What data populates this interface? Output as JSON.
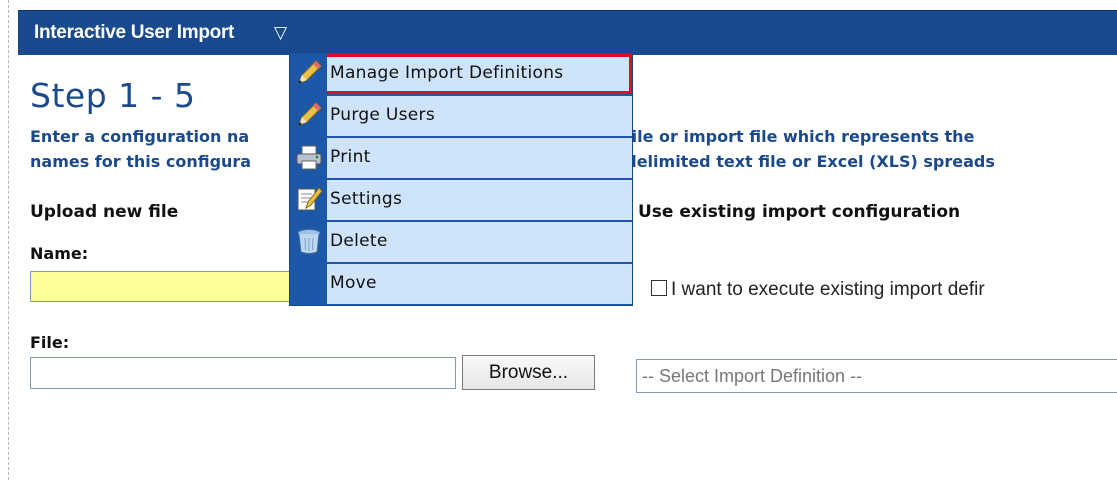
{
  "header": {
    "title": "Interactive User Import",
    "caret": "▽"
  },
  "step": {
    "title": "Step 1 - 5"
  },
  "description": {
    "line1_left": "Enter a configuration na",
    "line1_right": "ort file or import file which represents the",
    "line2_left": "names for this configura",
    "line2_right": "AB delimited text file or Excel (XLS) spreads"
  },
  "upload_section": {
    "title": "Upload new file",
    "name_label": "Name:",
    "name_value": "",
    "file_label": "File:",
    "file_value": "",
    "browse_label": "Browse..."
  },
  "existing_section": {
    "title": "Use existing import configuration",
    "checkbox_label": "I want to execute existing import defir",
    "checkbox_checked": false,
    "select_value": "-- Select Import Definition --"
  },
  "menu": {
    "items": [
      {
        "label": "Manage Import Definitions",
        "icon": "pencil-icon",
        "highlighted": true
      },
      {
        "label": "Purge Users",
        "icon": "pencil-icon"
      },
      {
        "label": "Print",
        "icon": "printer-icon"
      },
      {
        "label": "Settings",
        "icon": "notepad-pencil-icon"
      },
      {
        "label": "Delete",
        "icon": "trash-can-icon"
      },
      {
        "label": "Move",
        "icon": ""
      }
    ]
  },
  "colors": {
    "header_bg": "#194a8f",
    "menu_bg": "#cfe3fa",
    "menu_strip": "#1d57a8",
    "highlight_border": "#e0101a",
    "text_blue": "#1a4a8c",
    "name_input_bg": "#ffff99"
  }
}
